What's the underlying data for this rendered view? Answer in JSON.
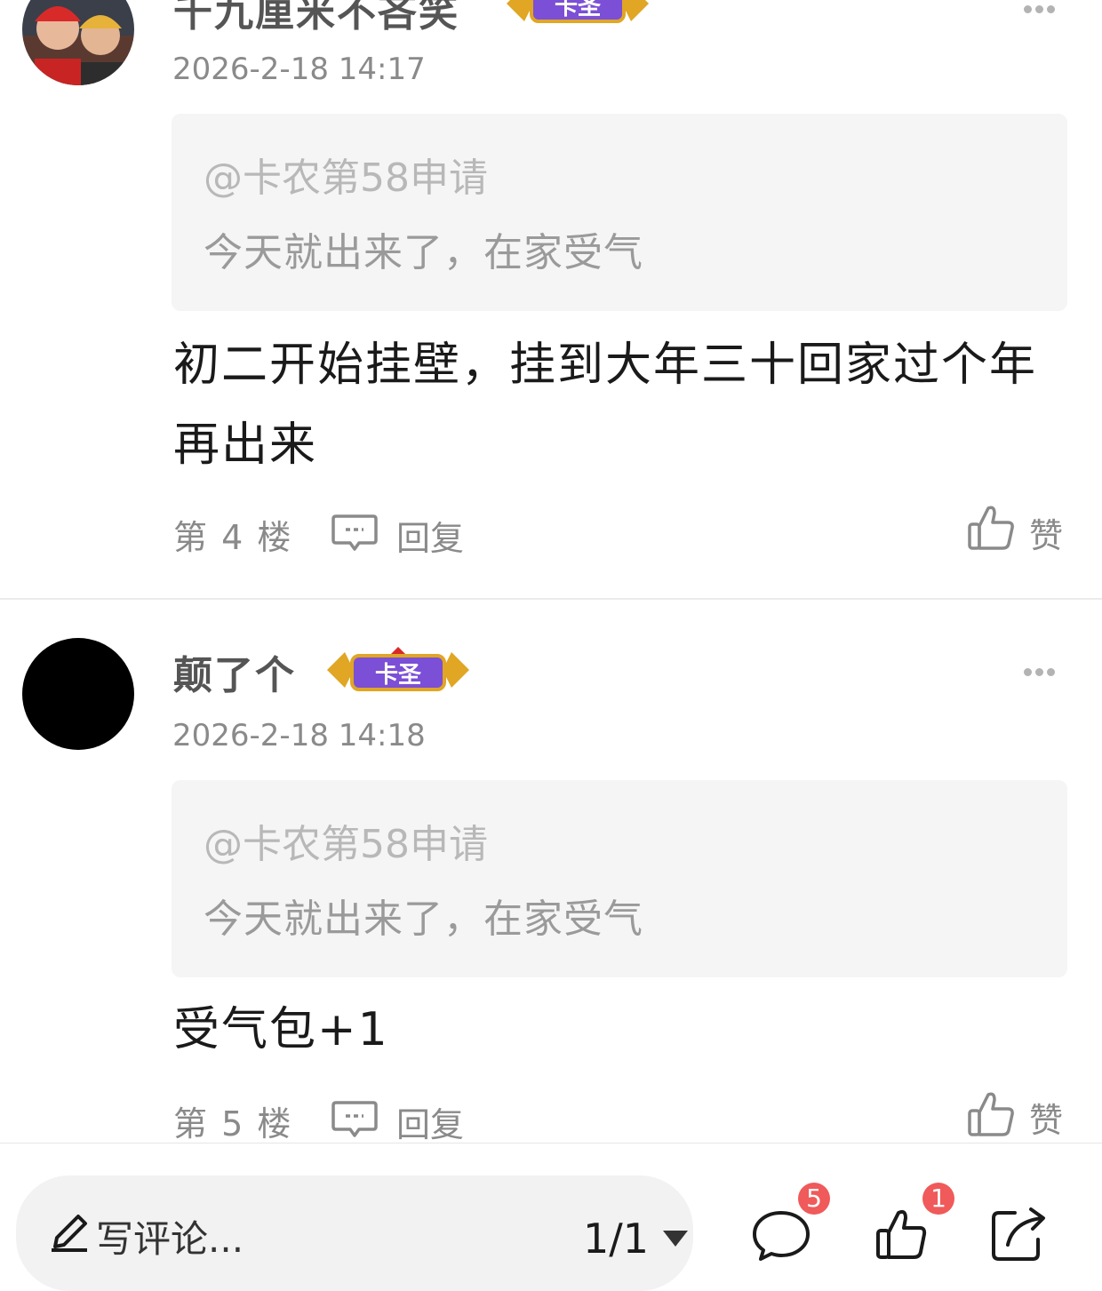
{
  "comments": [
    {
      "username": "千九厘米不吝笑",
      "badge_text": "卡圣",
      "time": "2026-2-18 14:17",
      "quote_user": "@卡农第58申请",
      "quote_text": "今天就出来了，在家受气",
      "content": "初二开始挂壁，挂到大年三十回家过个年再出来",
      "floor": "第 4 楼",
      "reply_label": "回复",
      "like_label": "赞"
    },
    {
      "username": "颠了个",
      "badge_text": "卡圣",
      "time": "2026-2-18 14:18",
      "quote_user": "@卡农第58申请",
      "quote_text": "今天就出来了，在家受气",
      "content": "受气包+1",
      "floor": "第 5 楼",
      "reply_label": "回复",
      "like_label": "赞"
    }
  ],
  "bottom_bar": {
    "write_placeholder": "写评论...",
    "page": "1/1",
    "comment_count": "5",
    "like_count": "1",
    "icons": [
      "pencil-icon",
      "caret-down-icon",
      "comment-bubble-icon",
      "thumbs-up-icon",
      "share-icon"
    ]
  },
  "colors": {
    "badge_purple": "#7b4fd6",
    "badge_gold": "#e0a624",
    "count_red": "#f05a5a",
    "quote_bg": "#f5f5f5"
  }
}
